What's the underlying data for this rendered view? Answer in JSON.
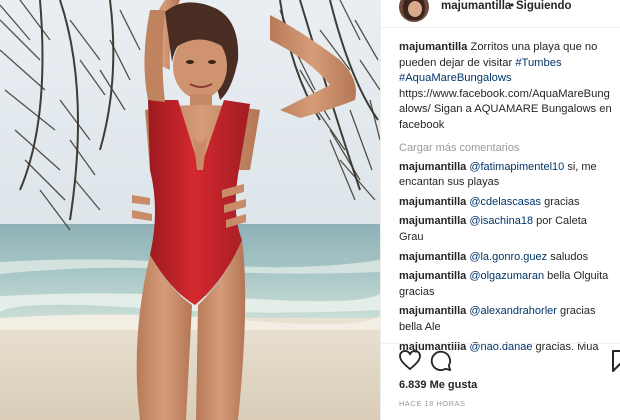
{
  "post": {
    "author": "majumantilla",
    "separator": "•",
    "follow_status": "Siguiendo",
    "photo_alt": "Photo"
  },
  "caption": {
    "username": "majumantilla",
    "text_1": "Zorritos una playa que no pueden dejar de visitar",
    "hashtag_1": "#Tumbes",
    "hashtag_2": "#AquaMareBungalows",
    "text_2": "https://www.facebook.com/AquaMareBungalows/ Sigan a AQUAMARE Bungalows en facebook"
  },
  "load_more": "Cargar más comentarios",
  "comments": [
    {
      "user": "majumantilla",
      "mention": "@fatimapimentel10",
      "text": "si, me encantan sus playas"
    },
    {
      "user": "majumantilla",
      "mention": "@cdelascasas",
      "text": "gracias"
    },
    {
      "user": "majumantilla",
      "mention": "@isachina18",
      "text": "por Caleta Grau"
    },
    {
      "user": "majumantilla",
      "mention": "@la.gonro.guez",
      "text": "saludos"
    },
    {
      "user": "majumantilla",
      "mention": "@olgazumaran",
      "text": "bella Olguita gracias"
    },
    {
      "user": "majumantilla",
      "mention": "@alexandrahorler",
      "text": "gracias bella Ale"
    },
    {
      "user": "majumantilla",
      "mention": "@nao.danae",
      "text": "gracias. Mua"
    }
  ],
  "likes": "6.839 Me gusta",
  "timestamp": "HACE 18 HORAS",
  "icons": {
    "like": "heart-icon",
    "comment": "comment-icon",
    "save": "bookmark-icon"
  },
  "colors": {
    "swimsuit": "#c8242c",
    "link": "#003569",
    "muted": "#999999",
    "text": "#262626"
  }
}
